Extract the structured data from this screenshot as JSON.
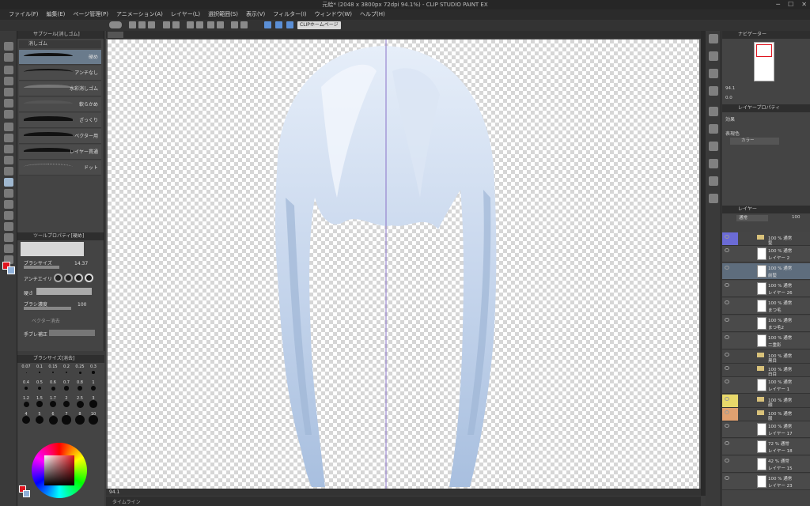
{
  "window": {
    "title": "元絵* (2048 x 3800px 72dpi 94.1%) - CLIP STUDIO PAINT EX"
  },
  "menu": [
    "ファイル(F)",
    "編集(E)",
    "ページ管理(P)",
    "アニメーション(A)",
    "レイヤー(L)",
    "選択範囲(S)",
    "表示(V)",
    "フィルター(I)",
    "ウィンドウ(W)",
    "ヘルプ(H)"
  ],
  "command_bar": {
    "home_button": "CLIPホームページ"
  },
  "subtool_panel": {
    "tab_label": "サブツール[消しゴム]",
    "group_label": "消しゴム",
    "brushes": [
      {
        "label": "硬め",
        "selected": true
      },
      {
        "label": "アンチなし",
        "selected": false
      },
      {
        "label": "水彩消しゴム",
        "selected": false
      },
      {
        "label": "軟らかめ",
        "selected": false
      },
      {
        "label": "ざっくり",
        "selected": false
      },
      {
        "label": "ベクター用",
        "selected": false
      },
      {
        "label": "レイヤー貫通",
        "selected": false
      },
      {
        "label": "ドット",
        "selected": false
      }
    ]
  },
  "tool_property": {
    "tab_label": "ツールプロパティ[硬め]",
    "brush_size_label": "ブラシサイズ",
    "brush_size_value": "14.37",
    "antialias_label": "アンチエイリ",
    "hardness_label": "硬さ",
    "density_label": "ブラシ濃度",
    "density_value": "100",
    "vector_erase_label": "ベクター消去",
    "stabilization_label": "手ブレ補正"
  },
  "brush_size_panel": {
    "tab_label": "ブラシサイズ[消去]",
    "sizes": [
      "0.07",
      "0.1",
      "0.15",
      "0.2",
      "0.25",
      "0.3",
      "0.4",
      "0.5",
      "0.6",
      "0.7",
      "0.8",
      "1",
      "1.2",
      "1.5",
      "1.7",
      "2",
      "2.5",
      "3",
      "4",
      "5",
      "6",
      "7",
      "8",
      "10"
    ]
  },
  "color_panel": {
    "hex_values": {
      "main": "#e0141e",
      "sub": "#8fb0d8"
    }
  },
  "navigator": {
    "tab_label": "ナビゲーター",
    "zoom": "94.1",
    "rotation": "0.0"
  },
  "layer_property": {
    "tab_label": "レイヤープロパティ",
    "effect_label": "効果",
    "expression_color_label": "表現色",
    "expression_color_value": "カラー"
  },
  "layer_panel": {
    "tab_label": "レイヤー",
    "blend_mode": "通常",
    "opacity": "100",
    "layers": [
      {
        "type": "folder",
        "blend": "100 % 通常",
        "name": "髪"
      },
      {
        "type": "layer",
        "blend": "100 % 通常",
        "name": "レイヤー 2"
      },
      {
        "type": "layer",
        "blend": "100 % 通常",
        "name": "前髪",
        "selected": true
      },
      {
        "type": "layer",
        "blend": "100 % 通常",
        "name": "レイヤー 26"
      },
      {
        "type": "layer",
        "blend": "100 % 通常",
        "name": "まつ毛"
      },
      {
        "type": "layer",
        "blend": "100 % 通常",
        "name": "まつ毛2"
      },
      {
        "type": "layer",
        "blend": "100 % 通常",
        "name": "二重影"
      },
      {
        "type": "folder",
        "blend": "100 % 通常",
        "name": "黒目"
      },
      {
        "type": "folder",
        "blend": "100 % 通常",
        "name": "白目"
      },
      {
        "type": "layer",
        "blend": "100 % 通常",
        "name": "レイヤー 1"
      },
      {
        "type": "folder",
        "blend": "100 % 通常",
        "name": "顔"
      },
      {
        "type": "folder",
        "blend": "100 % 通常",
        "name": "服"
      },
      {
        "type": "layer",
        "blend": "100 % 通常",
        "name": "レイヤー 17"
      },
      {
        "type": "layer",
        "blend": "72 % 通常",
        "name": "レイヤー 18"
      },
      {
        "type": "layer",
        "blend": "42 % 通常",
        "name": "レイヤー 15"
      },
      {
        "type": "layer",
        "blend": "100 % 通常",
        "name": "レイヤー 23"
      }
    ]
  },
  "status_bar": {
    "zoom": "94.1",
    "timeline_label": "タイムライン"
  }
}
